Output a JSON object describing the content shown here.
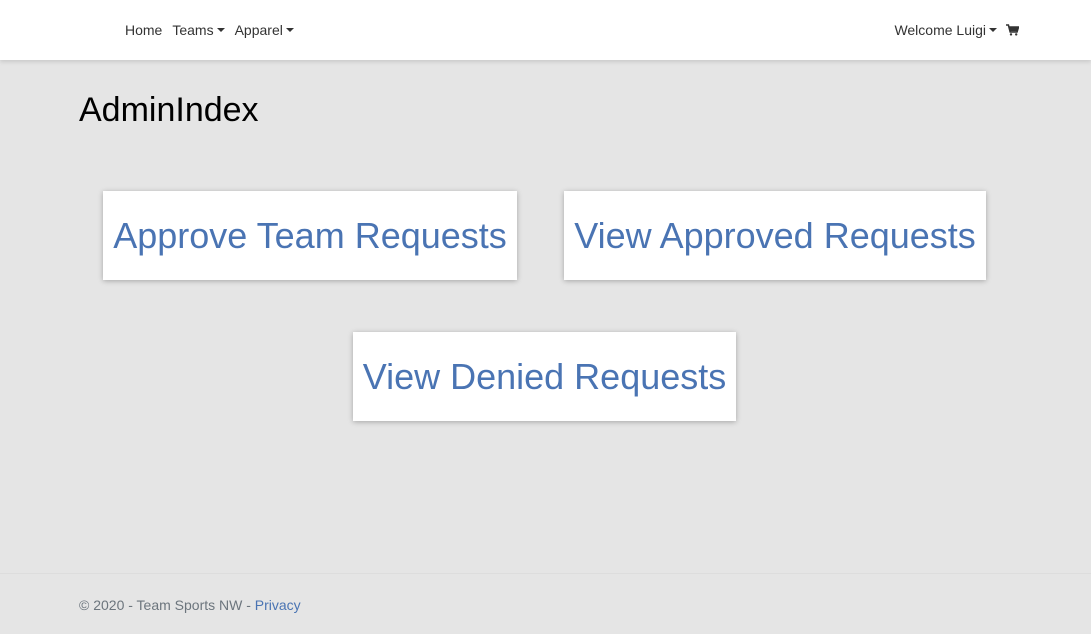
{
  "nav": {
    "left_items": [
      {
        "label": "Home",
        "has_dropdown": false
      },
      {
        "label": "Teams",
        "has_dropdown": true
      },
      {
        "label": "Apparel",
        "has_dropdown": true
      }
    ],
    "welcome_label": "Welcome Luigi",
    "cart_icon": "shopping-cart-icon"
  },
  "page": {
    "title": "AdminIndex"
  },
  "cards": [
    {
      "label": "Approve Team Requests"
    },
    {
      "label": "View Approved Requests"
    },
    {
      "label": "View Denied Requests"
    }
  ],
  "footer": {
    "text": "© 2020 - Team Sports NW - ",
    "privacy_label": "Privacy"
  },
  "colors": {
    "link": "#4a74b3",
    "background": "#e5e5e5",
    "navbar": "#ffffff"
  }
}
